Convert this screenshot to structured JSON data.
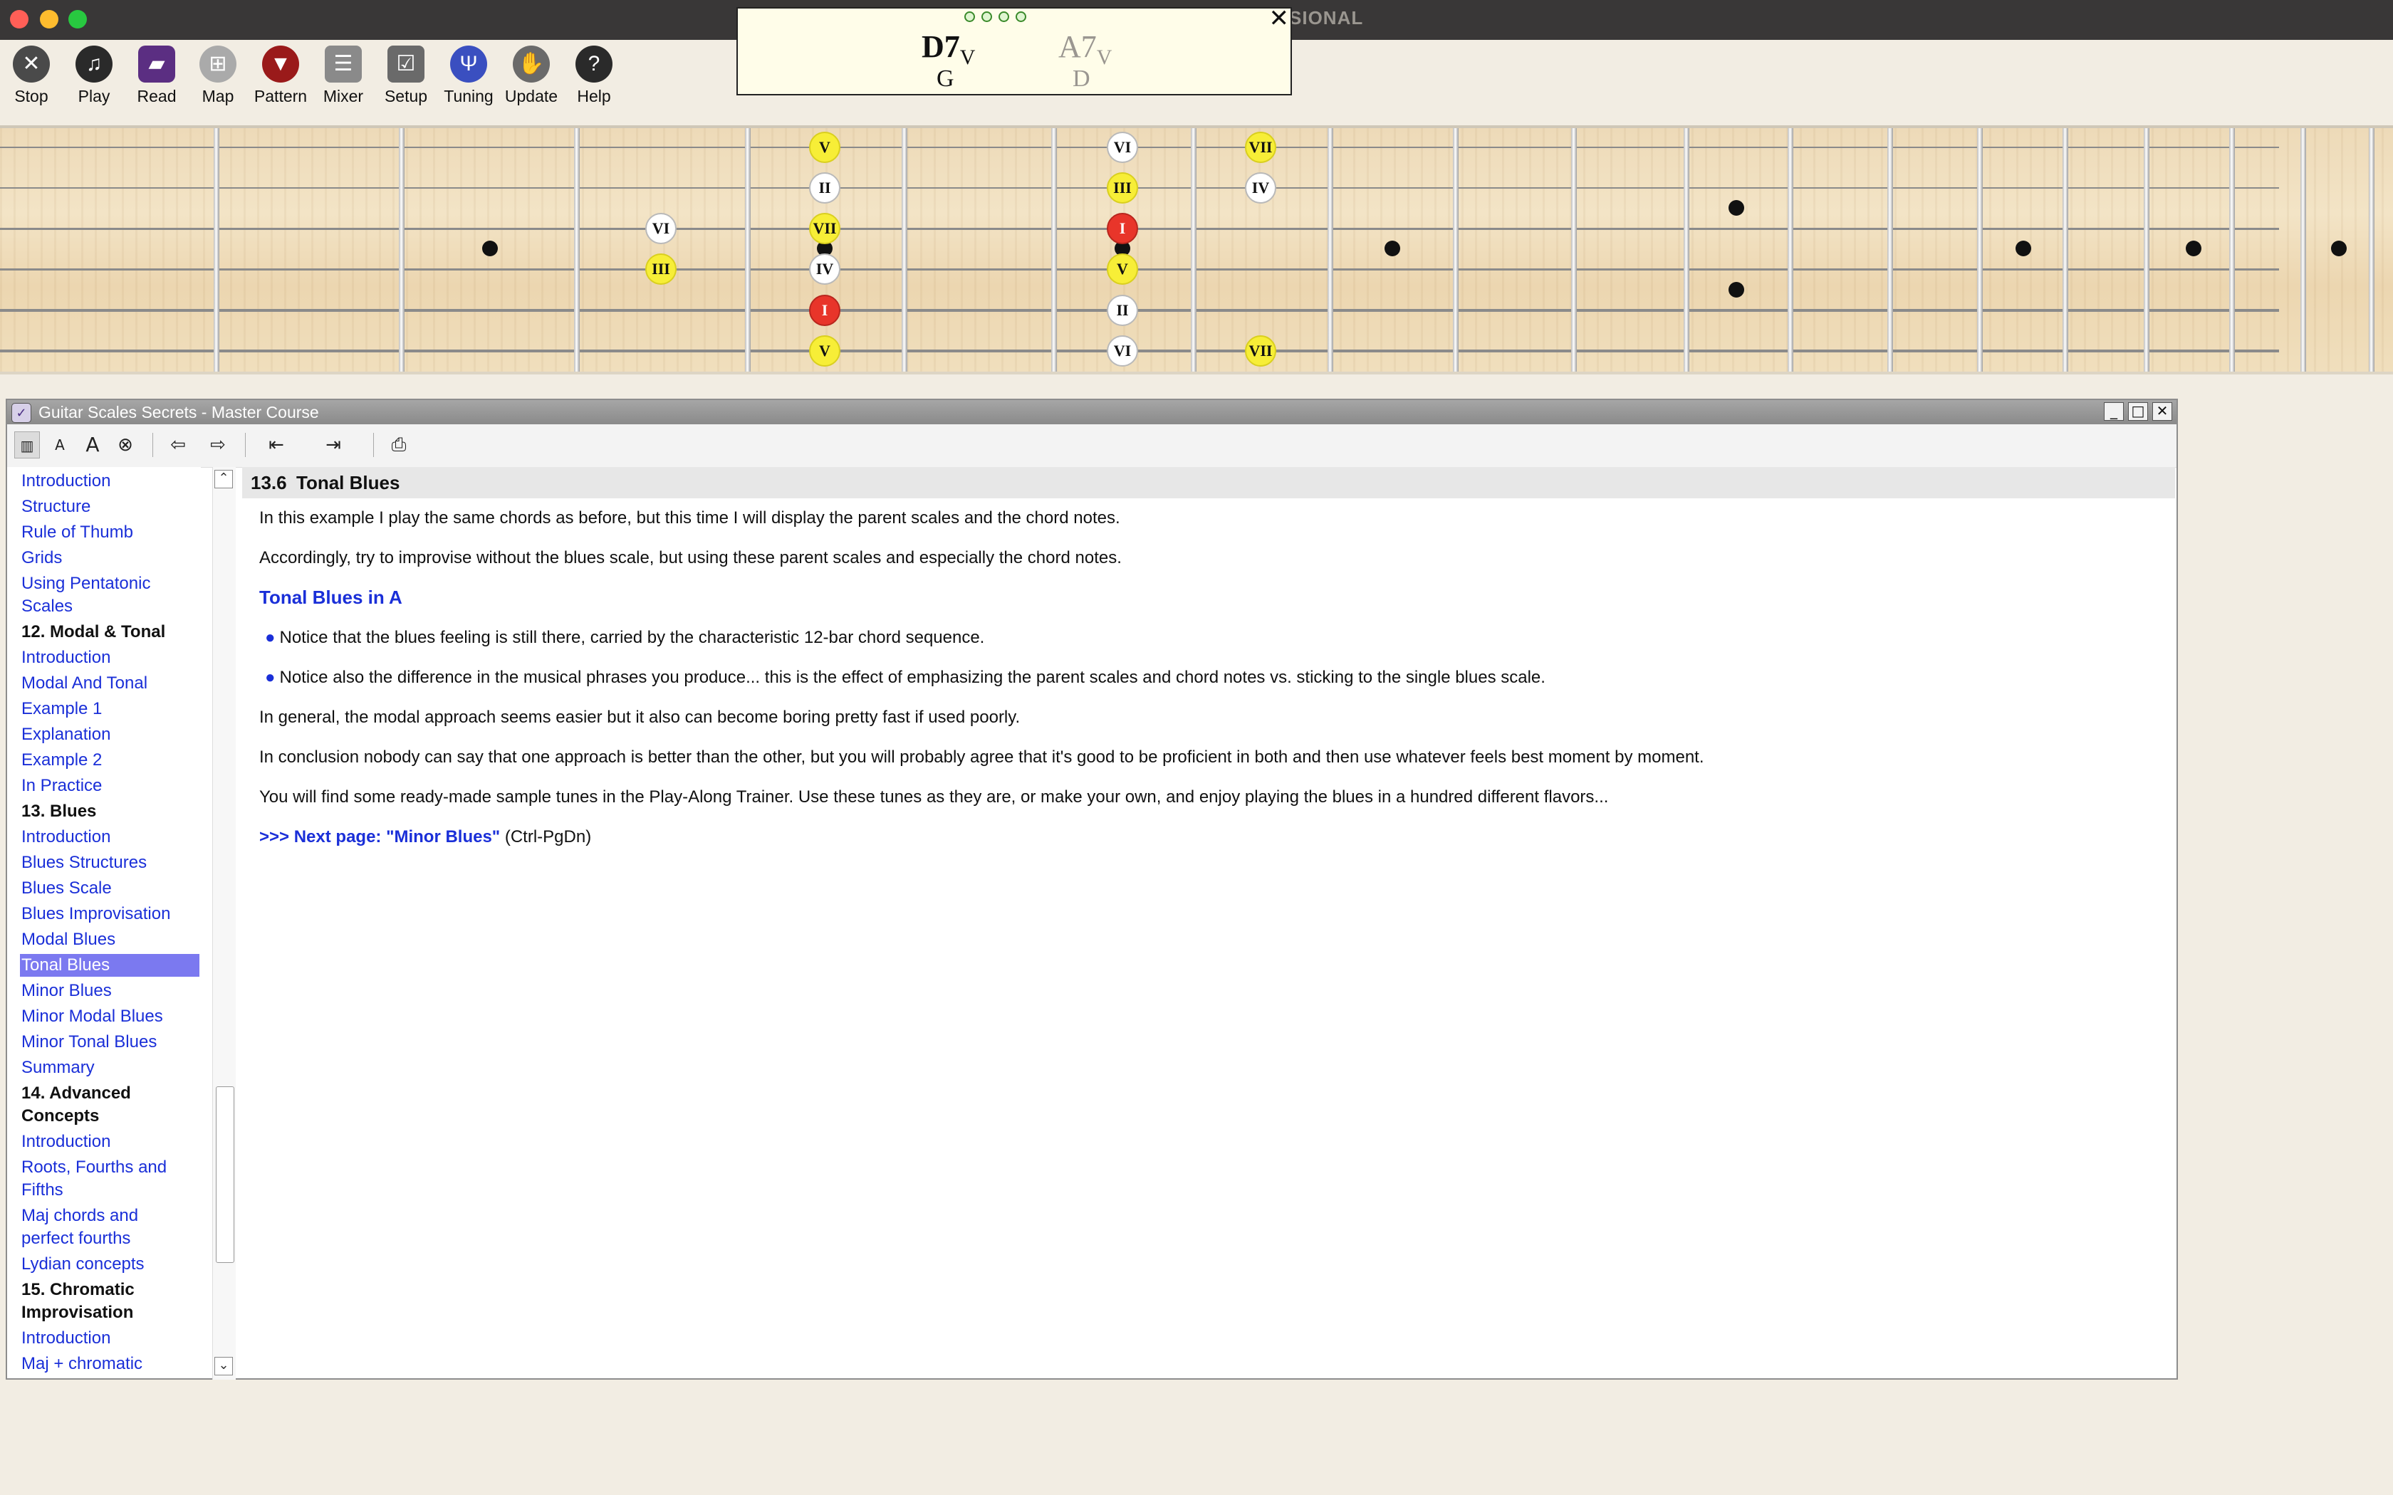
{
  "app_title": "SIONAL",
  "toolbar": {
    "buttons": [
      {
        "id": "stop",
        "label": "Stop",
        "icon": "stop-icon",
        "color": "#4a4a4a"
      },
      {
        "id": "play",
        "label": "Play",
        "icon": "music-note-icon",
        "color": "#1a1a1a"
      },
      {
        "id": "read",
        "label": "Read",
        "icon": "book-icon",
        "color": "#5b2e82"
      },
      {
        "id": "map",
        "label": "Map",
        "icon": "map-icon",
        "color": "#aaaaaa"
      },
      {
        "id": "pattern",
        "label": "Pattern",
        "icon": "guitar-pick-icon",
        "color": "#9a1a1a"
      },
      {
        "id": "mixer",
        "label": "Mixer",
        "icon": "mixer-icon",
        "color": "#8a8a8a"
      },
      {
        "id": "setup",
        "label": "Setup",
        "icon": "checkbox-icon",
        "color": "#6a6a6a"
      },
      {
        "id": "tuning",
        "label": "Tuning",
        "icon": "tuning-fork-icon",
        "color": "#3a4fc0"
      },
      {
        "id": "update",
        "label": "Update",
        "icon": "hand-icon",
        "color": "#6a6a6a"
      },
      {
        "id": "help",
        "label": "Help",
        "icon": "help-icon",
        "color": "#2a2a2a"
      }
    ]
  },
  "chord_popup": {
    "current_chord": "D7",
    "current_degree": "V",
    "current_bass": "G",
    "next_chord": "A7",
    "next_degree": "V",
    "next_bass": "D",
    "close_symbol": "✕"
  },
  "fretboard": {
    "notes": [
      {
        "label": "V",
        "style": "yellow"
      },
      {
        "label": "II",
        "style": "white"
      },
      {
        "label": "VII",
        "style": "yellow"
      },
      {
        "label": "IV",
        "style": "white"
      },
      {
        "label": "I",
        "style": "red"
      },
      {
        "label": "V",
        "style": "yellow"
      },
      {
        "label": "VI",
        "style": "white"
      },
      {
        "label": "III",
        "style": "yellow"
      },
      {
        "label": "VI",
        "style": "white"
      },
      {
        "label": "III",
        "style": "yellow"
      },
      {
        "label": "I",
        "style": "red"
      },
      {
        "label": "V",
        "style": "yellow"
      },
      {
        "label": "II",
        "style": "white"
      },
      {
        "label": "VI",
        "style": "white"
      },
      {
        "label": "VII",
        "style": "yellow"
      },
      {
        "label": "IV",
        "style": "white"
      },
      {
        "label": "VII",
        "style": "yellow"
      }
    ]
  },
  "course_window": {
    "title": "Guitar Scales Secrets  -  Master Course",
    "nav": [
      {
        "label": "Introduction",
        "type": "link"
      },
      {
        "label": "Structure",
        "type": "link"
      },
      {
        "label": "Rule of Thumb",
        "type": "link"
      },
      {
        "label": "Grids",
        "type": "link"
      },
      {
        "label": "Using Pentatonic",
        "type": "link"
      },
      {
        "label": "Scales",
        "type": "link"
      },
      {
        "label": "12. Modal & Tonal",
        "type": "header"
      },
      {
        "label": "Introduction",
        "type": "link"
      },
      {
        "label": "Modal And Tonal",
        "type": "link"
      },
      {
        "label": "Example 1",
        "type": "link"
      },
      {
        "label": "Explanation",
        "type": "link"
      },
      {
        "label": "Example 2",
        "type": "link"
      },
      {
        "label": "In Practice",
        "type": "link"
      },
      {
        "label": "13. Blues",
        "type": "header"
      },
      {
        "label": "Introduction",
        "type": "link"
      },
      {
        "label": "Blues Structures",
        "type": "link"
      },
      {
        "label": "Blues Scale",
        "type": "link"
      },
      {
        "label": "Blues Improvisation",
        "type": "link"
      },
      {
        "label": "Modal Blues",
        "type": "link"
      },
      {
        "label": "Tonal Blues",
        "type": "selected"
      },
      {
        "label": "Minor Blues",
        "type": "link"
      },
      {
        "label": "Minor Modal Blues",
        "type": "link"
      },
      {
        "label": "Minor Tonal Blues",
        "type": "link"
      },
      {
        "label": "Summary",
        "type": "link"
      },
      {
        "label": "14. Advanced",
        "type": "header"
      },
      {
        "label": "Concepts",
        "type": "header"
      },
      {
        "label": "Introduction",
        "type": "link"
      },
      {
        "label": "Roots, Fourths and",
        "type": "link"
      },
      {
        "label": "Fifths",
        "type": "link"
      },
      {
        "label": "Maj chords and",
        "type": "link"
      },
      {
        "label": "perfect fourths",
        "type": "link"
      },
      {
        "label": "Lydian concepts",
        "type": "link"
      },
      {
        "label": "15. Chromatic",
        "type": "header"
      },
      {
        "label": "Improvisation",
        "type": "header"
      },
      {
        "label": "Introduction",
        "type": "link"
      },
      {
        "label": "Maj + chromatic",
        "type": "link"
      }
    ],
    "content": {
      "section_number": "13.6",
      "section_title": "Tonal Blues",
      "p1": "In this example I play the same chords as before, but this time I will display the parent scales and the chord notes.",
      "p2": "Accordingly, try to improvise without the blues scale, but using these parent scales and especially the chord notes.",
      "subheading": "Tonal Blues in A",
      "bullet1": "Notice that the blues feeling is still there, carried by the characteristic 12-bar chord sequence.",
      "bullet2": "Notice also the difference in the musical phrases you produce... this is the effect of emphasizing the parent scales and chord notes vs. sticking to the single blues scale.",
      "p3": "In general, the modal approach seems easier but it also can become boring pretty fast if used poorly.",
      "p4": "In conclusion nobody can say that one approach is better than the other, but you will probably agree that it's good to be proficient in both and then use whatever feels best moment by moment.",
      "p5": "You will find some ready-made sample tunes in the Play-Along Trainer. Use these tunes as they are, or make your own, and enjoy playing the blues in a hundred different flavors...",
      "next_link": ">>> Next page: \"Minor Blues\"",
      "next_shortcut": " (Ctrl-PgDn)"
    }
  },
  "colors": {
    "link": "#1a2fd8",
    "selected_bg": "#7b79f0",
    "note_yellow": "#f7ee37",
    "note_red": "#e8352a",
    "note_white": "#ffffff"
  }
}
